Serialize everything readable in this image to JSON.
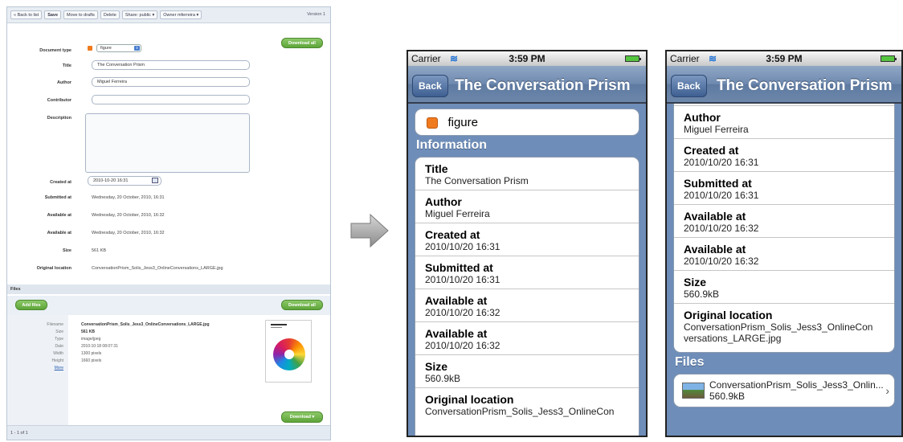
{
  "web": {
    "toolbar": {
      "back": "« Back to list",
      "save": "Save",
      "drafts": "Move to drafts",
      "delete": "Delete",
      "share": "Share: public",
      "owner": "Owner mferreira",
      "version": "Version 1"
    },
    "download_all": "Download all",
    "fields": {
      "doctype_label": "Document type",
      "doctype_value": "figure",
      "title_label": "Title",
      "title_value": "The Conversation Prism",
      "author_label": "Author",
      "author_value": "Miguel Ferreira",
      "contributor_label": "Contributor",
      "description_label": "Description",
      "created_label": "Created at",
      "created_value": "2010-10-20 16:31",
      "submitted_label": "Submitted at",
      "submitted_value": "Wednesday, 20 October, 2010, 16:31",
      "available1_label": "Available at",
      "available1_value": "Wednesday, 20 October, 2010, 16:32",
      "available2_label": "Available at",
      "available2_value": "Wednesday, 20 October, 2010, 16:32",
      "size_label": "Size",
      "size_value": "561 KB",
      "origloc_label": "Original location",
      "origloc_value": "ConversationPrism_Solis_Jess3_OnlineConversations_LARGE.jpg"
    },
    "files": {
      "header": "Files",
      "add_files": "Add files",
      "download_all": "Download all",
      "filename_label": "Filename",
      "filename_value": "ConversationPrism_Solis_Jess3_OnlineConversations_LARGE.jpg",
      "size_label": "Size",
      "size_value": "561 KB",
      "type_label": "Type",
      "type_value": "image/jpeg",
      "date_label": "Date",
      "date_value": "2010:10:18 08:07:31",
      "width_label": "Width",
      "width_value": "1300 pixels",
      "height_label": "Height",
      "height_value": "1660 pixels",
      "more": "More",
      "download": "Download"
    },
    "pagination": "1 - 1 of 1"
  },
  "phone1": {
    "carrier": "Carrier",
    "time": "3:59 PM",
    "back": "Back",
    "title": "The Conversation Prism",
    "type": "figure",
    "info_header": "Information",
    "cells": [
      {
        "t": "Title",
        "v": "The Conversation Prism"
      },
      {
        "t": "Author",
        "v": "Miguel Ferreira"
      },
      {
        "t": "Created at",
        "v": "2010/10/20 16:31"
      },
      {
        "t": "Submitted at",
        "v": "2010/10/20 16:31"
      },
      {
        "t": "Available at",
        "v": "2010/10/20 16:32"
      },
      {
        "t": "Available at",
        "v": "2010/10/20 16:32"
      },
      {
        "t": "Size",
        "v": "560.9kB"
      },
      {
        "t": "Original location",
        "v": "ConversationPrism_Solis_Jess3_OnlineCon"
      }
    ]
  },
  "phone2": {
    "carrier": "Carrier",
    "time": "3:59 PM",
    "back": "Back",
    "title": "The Conversation Prism",
    "cells": [
      {
        "t": "Author",
        "v": "Miguel Ferreira"
      },
      {
        "t": "Created at",
        "v": "2010/10/20 16:31"
      },
      {
        "t": "Submitted at",
        "v": "2010/10/20 16:31"
      },
      {
        "t": "Available at",
        "v": "2010/10/20 16:32"
      },
      {
        "t": "Available at",
        "v": "2010/10/20 16:32"
      },
      {
        "t": "Size",
        "v": "560.9kB"
      }
    ],
    "origloc_title": "Original location",
    "origloc_value": "ConversationPrism_Solis_Jess3_OnlineCon versations_LARGE.jpg",
    "files_header": "Files",
    "file_name": "ConversationPrism_Solis_Jess3_Onlin...",
    "file_size": "560.9kB"
  }
}
